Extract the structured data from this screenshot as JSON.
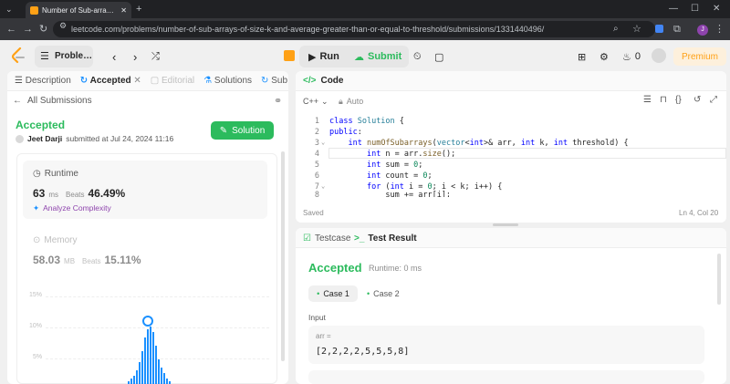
{
  "browser": {
    "tab_title": "Number of Sub-arrays of Size K",
    "url": "leetcode.com/problems/number-of-sub-arrays-of-size-k-and-average-greater-than-or-equal-to-threshold/submissions/1331440496/"
  },
  "toolbar": {
    "problem_list": "Proble…",
    "run": "Run",
    "submit": "Submit",
    "fire_count": "0",
    "premium": "Premium"
  },
  "left_tabs": {
    "description": "Description",
    "accepted": "Accepted",
    "editorial": "Editorial",
    "solutions": "Solutions",
    "submissions": "Sub"
  },
  "submission": {
    "back_label": "All Submissions",
    "status": "Accepted",
    "user": "Jeet Darji",
    "submitted_text": "submitted at Jul 24, 2024 11:16",
    "solution_button": "Solution"
  },
  "runtime": {
    "title": "Runtime",
    "value": "63",
    "unit": "ms",
    "beats_label": "Beats",
    "beats_value": "46.49%",
    "analyze_label": "Analyze Complexity"
  },
  "memory": {
    "title": "Memory",
    "value": "58.03",
    "unit": "MB",
    "beats_label": "Beats",
    "beats_value": "15.11%"
  },
  "chart_data": {
    "type": "bar",
    "y_tick_labels": [
      "15%",
      "10%",
      "5%"
    ],
    "ylim": [
      0,
      16
    ],
    "values": [
      0.5,
      1,
      1.5,
      2.5,
      4,
      6,
      8.5,
      10,
      10.5,
      9.5,
      7,
      4.5,
      3,
      2,
      1,
      0.5
    ],
    "highlight_index": 7
  },
  "editor": {
    "title": "Code",
    "language": "C++",
    "mode": "Auto",
    "saved": "Saved",
    "cursor": "Ln 4, Col 20",
    "lines": [
      "class Solution {",
      "public:",
      "    int numOfSubarrays(vector<int>& arr, int k, int threshold) {",
      "        int n = arr.size();",
      "        int sum = 0;",
      "        int count = 0;",
      "        for (int i = 0; i < k; i++) {",
      "            sum += arr[i];"
    ]
  },
  "result": {
    "testcase_tab": "Testcase",
    "test_result_tab": "Test Result",
    "status": "Accepted",
    "runtime": "Runtime: 0 ms",
    "case1": "Case 1",
    "case2": "Case 2",
    "input_label": "Input",
    "arr_label": "arr =",
    "arr_value": "[2,2,2,2,5,5,5,8]"
  }
}
